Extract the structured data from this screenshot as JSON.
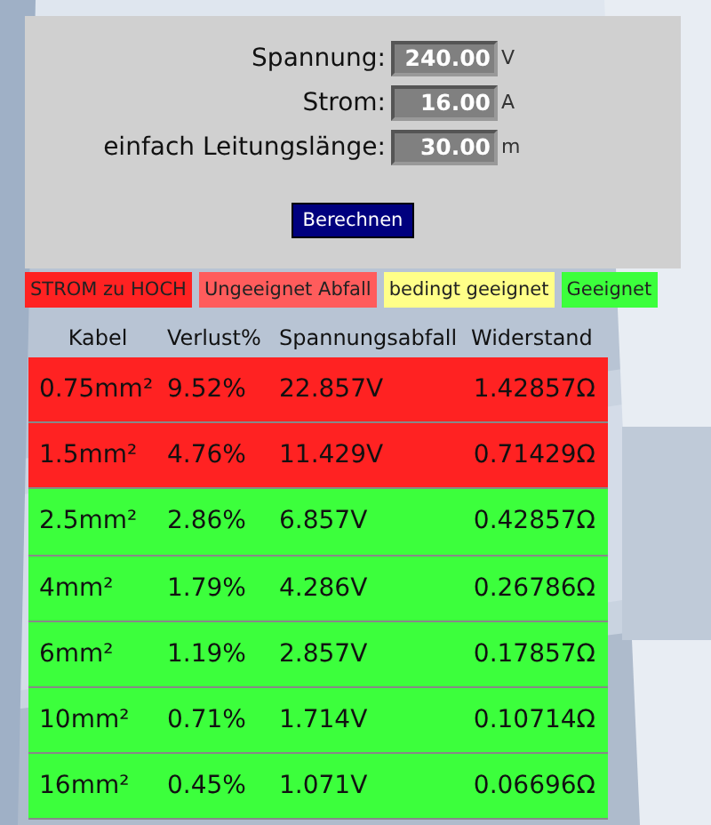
{
  "form": {
    "fields": [
      {
        "label": "Spannung:",
        "value": "240.00",
        "unit": "V"
      },
      {
        "label": "Strom:",
        "value": "16.00",
        "unit": "A"
      },
      {
        "label": "einfach Leitungslänge:",
        "value": "30.00",
        "unit": "m"
      }
    ],
    "button": "Berechnen"
  },
  "legend": [
    {
      "label": "STROM zu HOCH",
      "color": "#ff2222"
    },
    {
      "label": "Ungeeignet Abfall",
      "color": "#ff5c5c"
    },
    {
      "label": "bedingt geeignet",
      "color": "#ffff88"
    },
    {
      "label": "Geeignet",
      "color": "#3cff3c"
    }
  ],
  "table": {
    "columns": [
      "Kabel",
      "Verlust%",
      "Spannungsabfall",
      "Widerstand"
    ],
    "rows": [
      {
        "cells": [
          "0.75mm²",
          "9.52%",
          "22.857V",
          "1.42857Ω"
        ],
        "color": "#ff2222"
      },
      {
        "cells": [
          "1.5mm²",
          "4.76%",
          "11.429V",
          "0.71429Ω"
        ],
        "color": "#ff2222"
      },
      {
        "cells": [
          "2.5mm²",
          "2.86%",
          "6.857V",
          "0.42857Ω"
        ],
        "color": "#3cff3c"
      },
      {
        "cells": [
          "4mm²",
          "1.79%",
          "4.286V",
          "0.26786Ω"
        ],
        "color": "#3cff3c"
      },
      {
        "cells": [
          "6mm²",
          "1.19%",
          "2.857V",
          "0.17857Ω"
        ],
        "color": "#3cff3c"
      },
      {
        "cells": [
          "10mm²",
          "0.71%",
          "1.714V",
          "0.10714Ω"
        ],
        "color": "#3cff3c"
      },
      {
        "cells": [
          "16mm²",
          "0.45%",
          "1.071V",
          "0.06696Ω"
        ],
        "color": "#3cff3c"
      }
    ]
  }
}
